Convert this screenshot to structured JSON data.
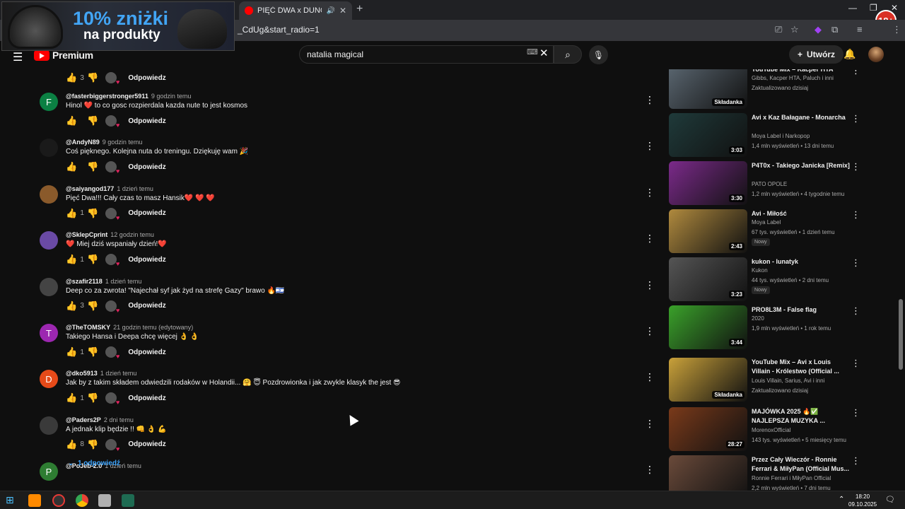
{
  "browser": {
    "tab_title": "PIĘĆ DWA x DUNCAN x HI",
    "url": "_CdUg&start_radio=1",
    "badge": "18+"
  },
  "ad": {
    "headline": "10% zniżki",
    "subline": "na produkty"
  },
  "youtube": {
    "logo_text": "Premium",
    "search_value": "natalia magical",
    "create_label": "Utwórz"
  },
  "top_actions": {
    "likes": "3",
    "reply_label": "Odpowiedz"
  },
  "comments": [
    {
      "author": "@fasterbiggerstronger5911",
      "time": "9 godzin temu",
      "text": "Hinol ❤️ to co gosc rozpierdala kazda nute to jest kosmos",
      "likes": "",
      "avatar_letter": "F",
      "avatar_color": "#0b8043",
      "reply_label": "Odpowiedz"
    },
    {
      "author": "@AndyN89",
      "time": "9 godzin temu",
      "text": "Coś pięknego. Kolejna nuta do treningu. Dziękuję wam 🎉",
      "likes": "",
      "avatar_letter": "",
      "avatar_color": "#1a1a1a",
      "reply_label": "Odpowiedz"
    },
    {
      "author": "@saiyangod177",
      "time": "1 dzień temu",
      "text": "Pięć Dwa!!! Cały czas to masz Hansik❤️ ❤️ ❤️",
      "likes": "1",
      "avatar_letter": "",
      "avatar_color": "#8a5a2b",
      "reply_label": "Odpowiedz"
    },
    {
      "author": "@SklepCprint",
      "time": "12 godzin temu",
      "text": "❤️ Miej dziś wspaniały dzień!❤️",
      "likes": "1",
      "avatar_letter": "",
      "avatar_color": "#6a4aa5",
      "reply_label": "Odpowiedz"
    },
    {
      "author": "@szafir2118",
      "time": "1 dzień temu",
      "text": "Deep co za zwrota! \"Najechał syf jak żyd na strefę Gazy\" brawo 🔥🇮🇱",
      "likes": "3",
      "avatar_letter": "",
      "avatar_color": "#444444",
      "reply_label": "Odpowiedz"
    },
    {
      "author": "@TheTOMSKY",
      "time": "21 godzin temu (edytowany)",
      "text": "Takiego Hansa i Deepa chcę więcej 👌 👌",
      "likes": "1",
      "avatar_letter": "T",
      "avatar_color": "#9c27b0",
      "reply_label": "Odpowiedz"
    },
    {
      "author": "@dko5913",
      "time": "1 dzień temu",
      "text": "Jak by z takim składem odwiedzili rodaków w Holandii... 🤗 😇 Pozdrowionka i jak zwykle klasyk the jest 😎",
      "likes": "1",
      "avatar_letter": "D",
      "avatar_color": "#e64a19",
      "reply_label": "Odpowiedz"
    },
    {
      "author": "@Paders2P",
      "time": "2 dni temu",
      "text": "A jednak klip będzie !! 👊 👌 💪",
      "likes": "8",
      "avatar_letter": "",
      "avatar_color": "#3a3a3a",
      "reply_label": "Odpowiedz"
    },
    {
      "author": "@PoJeb-2.0",
      "time": "1 dzień temu",
      "text": "",
      "likes": "",
      "avatar_letter": "P",
      "avatar_color": "#2e7d32",
      "reply_label": "Odpowiedz"
    }
  ],
  "replies_link": "1 odpowiedź",
  "sidebar": [
    {
      "title": "YouTube Mix – Kacper HTA",
      "channel": "Gibbs, Kacper HTA, Paluch i inni",
      "meta": "Zaktualizowano dzisiaj",
      "duration": "Składanka",
      "new": "",
      "thumb": "#5a6670"
    },
    {
      "title": "Avi x Kaz Bałagane - Monarcha",
      "channel": "Moya Label i Narkopop",
      "meta": "1,4 mln wyświetleń • 13 dni temu",
      "duration": "3:03",
      "new": "",
      "thumb": "#1f3a3a"
    },
    {
      "title": "P4T0x - Takiego Janicka [Remix]",
      "channel": "PATO OPOLE",
      "meta": "1,2 mln wyświetleń • 4 tygodnie temu",
      "duration": "3:30",
      "new": "",
      "thumb": "#7b2a8a"
    },
    {
      "title": "Avi - Miłość",
      "channel": "Moya Label",
      "meta": "67 tys. wyświetleń • 1 dzień temu",
      "duration": "2:43",
      "new": "Nowy",
      "thumb": "#b08a3e"
    },
    {
      "title": "kukon - lunatyk",
      "channel": "Kukon",
      "meta": "44 tys. wyświetleń • 2 dni temu",
      "duration": "3:23",
      "new": "Nowy",
      "thumb": "#555555"
    },
    {
      "title": "PRO8L3M - False flag",
      "channel": "2020",
      "meta": "1,9 mln wyświetleń • 1 rok temu",
      "duration": "3:44",
      "new": "",
      "thumb": "#3aa12a"
    },
    {
      "title": "YouTube Mix – Avi x Louis Villain - Królestwo (Official ...",
      "channel": "Louis Villain, Sarius, Avi i inni",
      "meta": "Zaktualizowano dzisiaj",
      "duration": "Składanka",
      "new": "",
      "thumb": "#c9a13a"
    },
    {
      "title": "MAJÓWKA 2025 🔥✅ NAJLEPSZA MUZYKA ...",
      "channel": "MorenoxOfficial",
      "meta": "143 tys. wyświetleń • 5 miesięcy temu",
      "duration": "28:27",
      "new": "",
      "thumb": "#7a3a1a"
    },
    {
      "title": "Przez Cały Wieczór - Ronnie Ferrari & MiłyPan (Official Mus...",
      "channel": "Ronnie Ferrari i MiłyPan Official",
      "meta": "2,2 mln wyświetleń • 7 dni temu",
      "duration": "",
      "new": "",
      "thumb": "#6a4a3a"
    }
  ],
  "taskbar": {
    "time": "18:20",
    "date": "09.10.2025"
  }
}
